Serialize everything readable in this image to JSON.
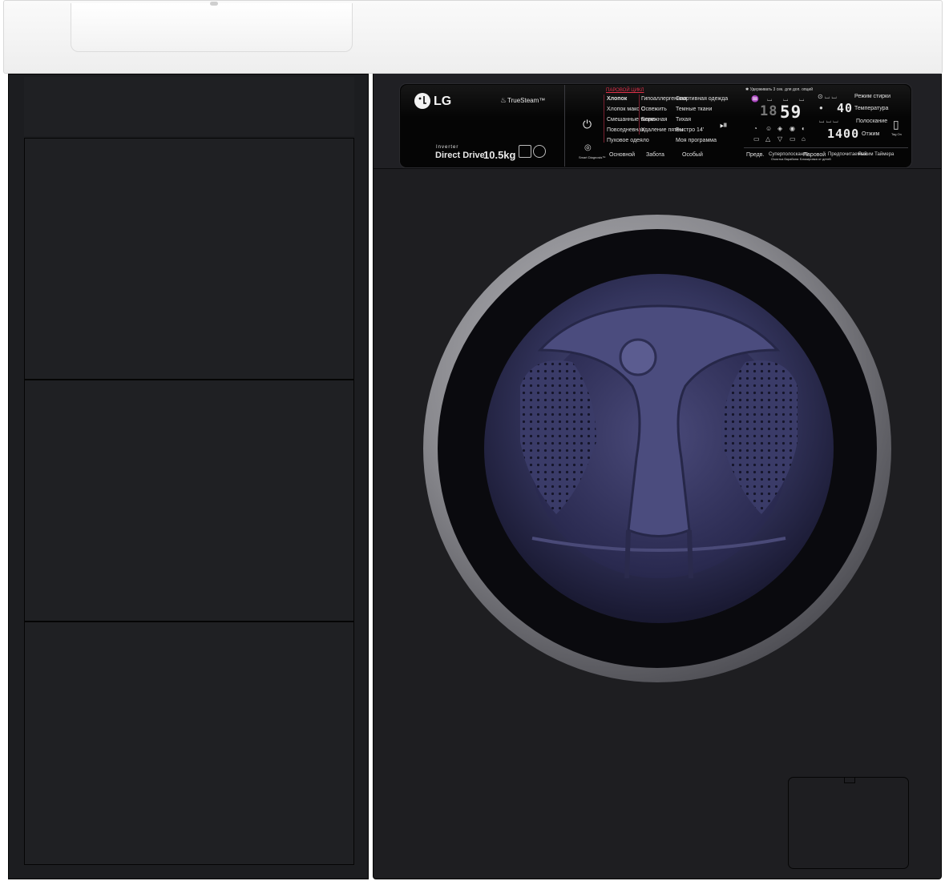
{
  "brand": "LG",
  "panel": {
    "truesteam_label": "TrueSteam™",
    "inverter_label": "Inverter",
    "direct_drive_label": "Direct Drive",
    "capacity_label": "10.5kg",
    "steam_cycle_header": "ПАРОВОЙ ЦИКЛ",
    "hold_hint": "✱ Удерживать 3 сек. для доп. опций",
    "programs_col1": [
      "Хлопок",
      "Хлопок макс C",
      "Смешанные ткани",
      "Повседневная",
      "Пуховое одеяло"
    ],
    "programs_col2": [
      "Гипоаллергенная",
      "Освежить",
      "Бережная",
      "Удаление пятен"
    ],
    "programs_col3": [
      "Спортивная одежда",
      "Темные ткани",
      "Тихая",
      "Быстро 14'",
      "Моя программа"
    ],
    "group_labels": [
      "Основной",
      "Забота",
      "Особый"
    ],
    "smart_diagnosis_label": "Smart Diagnosis™",
    "display_time": "59",
    "display_time_prefix": "18",
    "temperature_value": "40",
    "spin_value": "1400",
    "right_options": [
      "Режим стирки",
      "Температура",
      "Полоскание",
      "Отжим"
    ],
    "bottom_options": [
      "Предв.",
      "Суперполоскание",
      "Паровой",
      "Предпочитаемый",
      "Режим Таймера"
    ],
    "bottom_sub_labels": [
      "Очистка барабана",
      "Блокировка от детей"
    ],
    "tag_on_label": "Tag On",
    "colors": {
      "panel_bg": "#050505",
      "body": "#1e1e21",
      "accent_red": "#e0314a",
      "drum_glass": "#33345c"
    }
  }
}
